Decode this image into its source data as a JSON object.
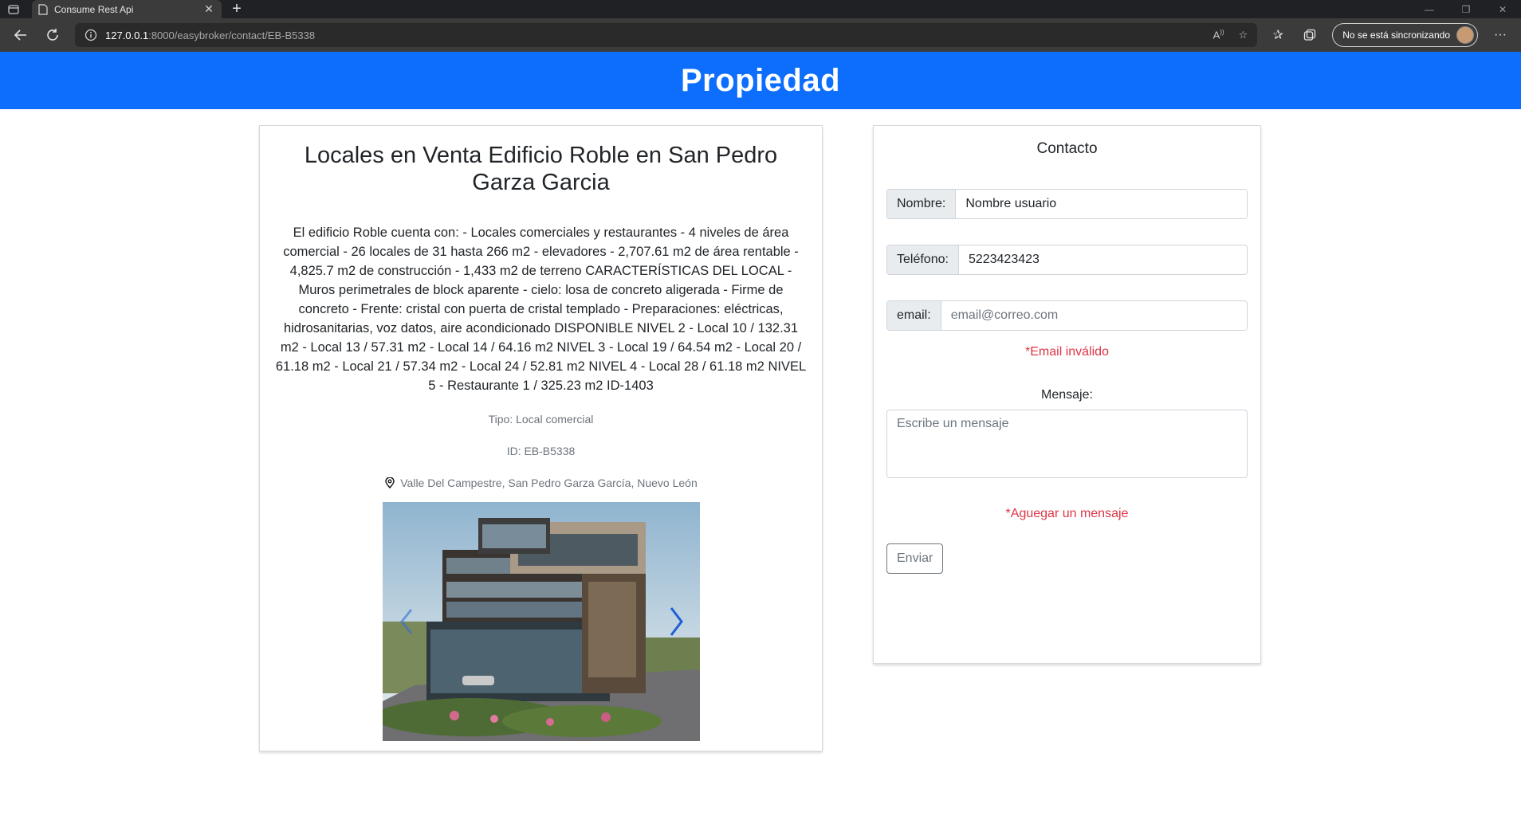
{
  "browser": {
    "tab_title": "Consume Rest Api",
    "url_host": "127.0.0.1",
    "url_path": ":8000/easybroker/contact/EB-B5338",
    "sync_label": "No se está sincronizando"
  },
  "header": {
    "title": "Propiedad"
  },
  "property": {
    "title": "Locales en Venta Edificio Roble en San Pedro Garza Garcia",
    "description": "El edificio Roble cuenta con: - Locales comerciales y restaurantes - 4 niveles de área comercial - 26 locales de 31 hasta 266 m2 - elevadores - 2,707.61 m2 de área rentable - 4,825.7 m2 de construcción - 1,433 m2 de terreno CARACTERÍSTICAS DEL LOCAL - Muros perimetrales de block aparente - cielo: losa de concreto aligerada - Firme de concreto - Frente: cristal con puerta de cristal templado - Preparaciones: eléctricas, hidrosanitarias, voz datos, aire acondicionado DISPONIBLE NIVEL 2 - Local 10 / 132.31 m2 - Local 13 / 57.31 m2 - Local 14 / 64.16 m2 NIVEL 3 - Local 19 / 64.54 m2 - Local 20 / 61.18 m2 - Local 21 / 57.34 m2 - Local 24 / 52.81 m2 NIVEL 4 - Local 28 / 61.18 m2 NIVEL 5 - Restaurante 1 / 325.23 m2 ID-1403",
    "tipo": "Tipo: Local comercial",
    "id": "ID: EB-B5338",
    "location": "Valle Del Campestre, San Pedro Garza García, Nuevo León"
  },
  "contact": {
    "title": "Contacto",
    "nombre_label": "Nombre:",
    "nombre_value": "Nombre usuario",
    "telefono_label": "Teléfono:",
    "telefono_value": "5223423423",
    "email_label": "email:",
    "email_placeholder": "email@correo.com",
    "email_error": "*Email inválido",
    "mensaje_label": "Mensaje:",
    "mensaje_placeholder": "Escribe un mensaje",
    "mensaje_error": "*Aguegar un mensaje",
    "send_label": "Enviar"
  },
  "colors": {
    "header_bg": "#0d6efd",
    "error": "#dc3545",
    "chrome_bg": "#202124"
  },
  "icons": [
    "window-icon",
    "page-icon",
    "close-icon",
    "plus-icon",
    "back-arrow-icon",
    "reload-icon",
    "info-icon",
    "read-aloud-icon",
    "add-favorite-icon",
    "favorites-icon",
    "collections-icon",
    "more-icon",
    "location-pin-icon",
    "chevron-left-icon",
    "chevron-right-icon"
  ]
}
